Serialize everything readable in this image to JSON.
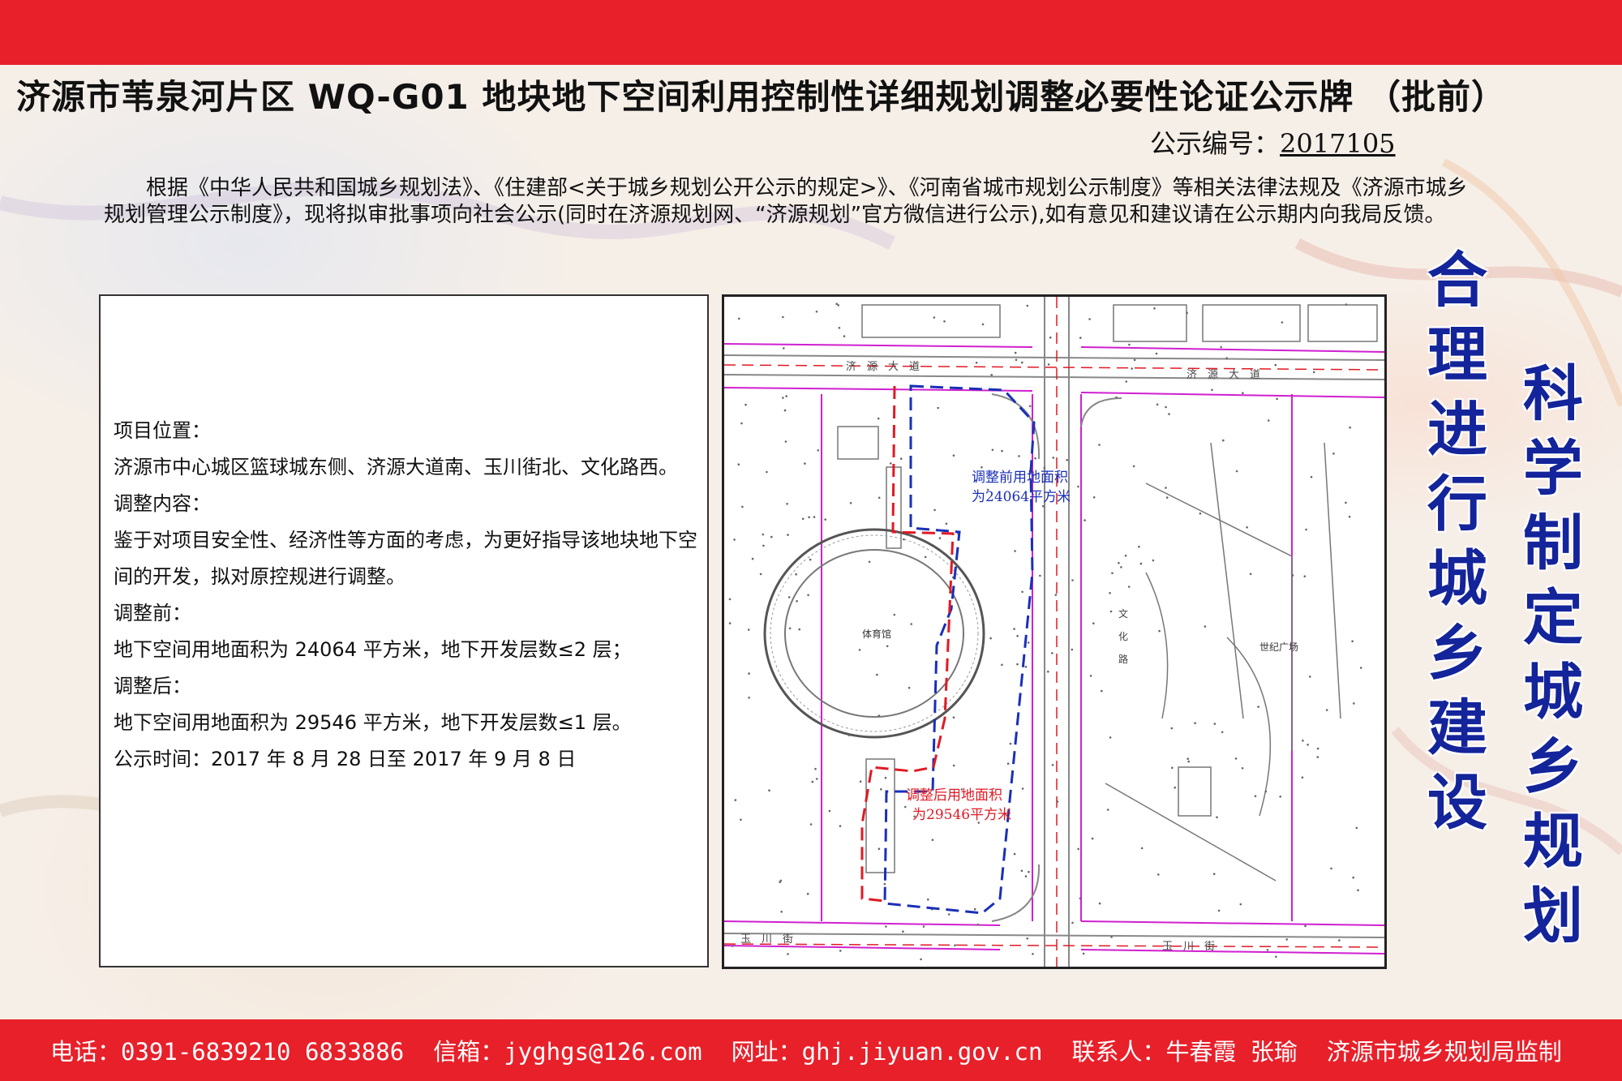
{
  "header": {
    "title": "济源市苇泉河片区 WQ-G01 地块地下空间利用控制性详细规划调整必要性论证公示牌 （批前）",
    "serial_label": "公示编号：",
    "serial_number": "2017105"
  },
  "intro": "根据《中华人民共和国城乡规划法》、《住建部<关于城乡规划公开公示的规定>》、《河南省城市规划公示制度》等相关法律法规及《济源市城乡规划管理公示制度》，现将拟审批事项向社会公示(同时在济源规划网、“济源规划”官方微信进行公示),如有意见和建议请在公示期内向我局反馈。",
  "info": {
    "location_heading": "项目位置：",
    "location_text": "济源市中心城区篮球城东侧、济源大道南、玉川街北、文化路西。",
    "content_heading": "调整内容：",
    "content_text": "鉴于对项目安全性、经济性等方面的考虑，为更好指导该地块地下空间的开发，拟对原控规进行调整。",
    "before_heading": "调整前：",
    "before_text": "地下空间用地面积为 24064 平方米，地下开发层数≤2 层；",
    "after_heading": "调整后：",
    "after_text": "地下空间用地面积为 29546 平方米，地下开发层数≤1 层。",
    "period": "公示时间：2017 年 8 月 28 日至 2017 年 9 月 8 日"
  },
  "map": {
    "before_area_label_1": "调整前用地面积",
    "before_area_label_2": "为24064平方米",
    "after_area_label_1": "调整后用地面积",
    "after_area_label_2": "为29546平方米",
    "road_north_left": "济　源　大　道",
    "road_north_right": "济　源　大　道",
    "road_east": "文\n化\n路",
    "road_south_left": "玉　川　街",
    "road_south_right": "玉　川　街",
    "stadium_label": "体育馆",
    "plaza_label": "世纪广场",
    "colors": {
      "before_boundary": "#1a2fb8",
      "after_boundary": "#e01a24",
      "road_line": "#d020d0"
    }
  },
  "slogans": {
    "left": "合理进行城乡建设",
    "right": "科学制定城乡规划"
  },
  "footer": {
    "phone": "电话：0391-6839210 6833886",
    "email": "信箱：jyghgs@126.com",
    "website": "网址：ghj.jiyuan.gov.cn",
    "contact": "联系人：牛春霞 张瑜",
    "supervisor": "济源市城乡规划局监制"
  },
  "theme": {
    "banner_red": "#e8202a",
    "slogan_blue": "#14249a"
  }
}
